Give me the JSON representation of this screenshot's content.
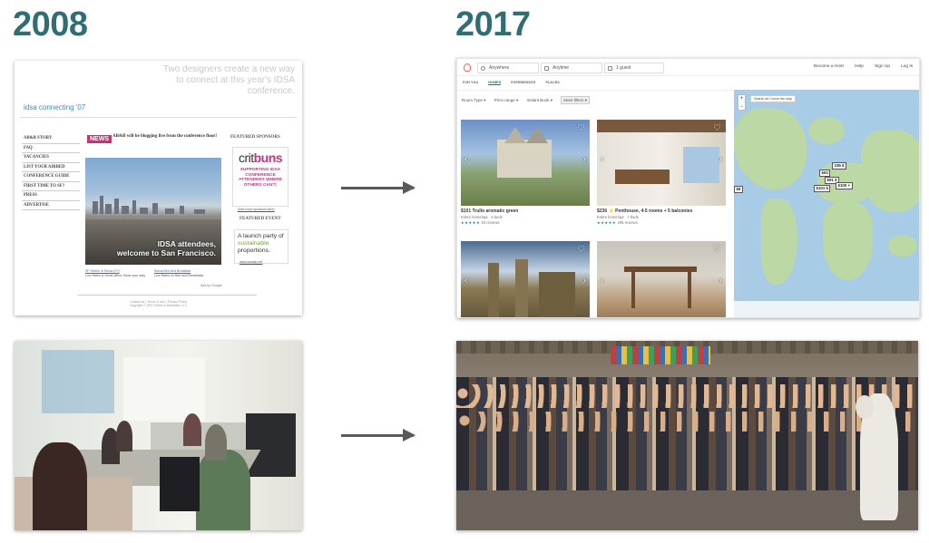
{
  "header": {
    "left_year": "2008",
    "right_year": "2017"
  },
  "site_2008": {
    "tagline": "Two designers create a new way to connect at this year's IDSA conference.",
    "connecting": "idsa connecting '07",
    "nav": [
      "AB&B STORY",
      "FAQ",
      "VACANCIES",
      "LIST YOUR AIRBED",
      "CONFERENCE GUIDE",
      "FIRST TIME TO SF?",
      "PRESS",
      "ADVERTISE"
    ],
    "news_badge": "NEWS",
    "news_text": "AB&B will be blogging live from the conference floor!",
    "hero_caption_1": "IDSA attendees,",
    "hero_caption_2": "welcome to San Francisco.",
    "ad_link_1": "SF Hotels In Soma (2?)",
    "ad_text_1": "Low Rates & Great offers. Book your stay",
    "ad_link_2": "Soma Bed And Breakfast",
    "ad_text_2": "Low Rates on Bed and Breakfasts",
    "ads_by": "Ads by Google",
    "featured_sponsors": "FEATURED SPONSORS",
    "sponsor_name_a": "crit",
    "sponsor_name_b": "buns",
    "sponsor_text": "SUPPORTING IDSA CONFERENCE ATTENDEES WHERE OTHERS CAN'T.",
    "see_more": "(See more sponsors here)",
    "featured_event": "FEATURED EVENT",
    "event_a": "A launch party of ",
    "event_b": "sustainable",
    "event_c": " proportions.",
    "event_url": "www.sustain.net",
    "footer_1": "Contact us | Terms of Use | Privacy Policy",
    "footer_2": "Copyright © 2007 Airbed & Breakfast, LLC"
  },
  "site_2017": {
    "search_where": "Anywhere",
    "search_when": "Anytime",
    "search_guests": "1 guest",
    "nav_links": [
      "Become a Host",
      "Help",
      "Sign Up",
      "Log In"
    ],
    "tabs": [
      "FOR YOU",
      "HOMES",
      "EXPERIENCES",
      "PLACES"
    ],
    "active_tab": "HOMES",
    "filters": [
      "Room Type ▾",
      "Price range ▾",
      "Instant Book ▾",
      "More filters ▾"
    ],
    "listings": [
      {
        "title": "$101 Trullo aromatic green",
        "sub": "Entire home/apt · 4 beds",
        "stars": "★★★★★",
        "reviews": "34 reviews"
      },
      {
        "title": "$236 ⚡ Penthouse, 4-5 rooms + 5 balconies",
        "sub": "Entire home/apt · 7 beds",
        "stars": "★★★★★",
        "reviews": "265 reviews"
      }
    ],
    "map_checkbox": "Search as I move the map",
    "map_pins": [
      "236 $",
      "$63",
      "$91 $",
      "$101 $",
      "$100 +",
      "$8"
    ]
  },
  "colors": {
    "year": "#2f6f73",
    "accent_2008": "#c0357a",
    "accent_2017": "#008489",
    "brand_2017": "#ff5a5f"
  }
}
